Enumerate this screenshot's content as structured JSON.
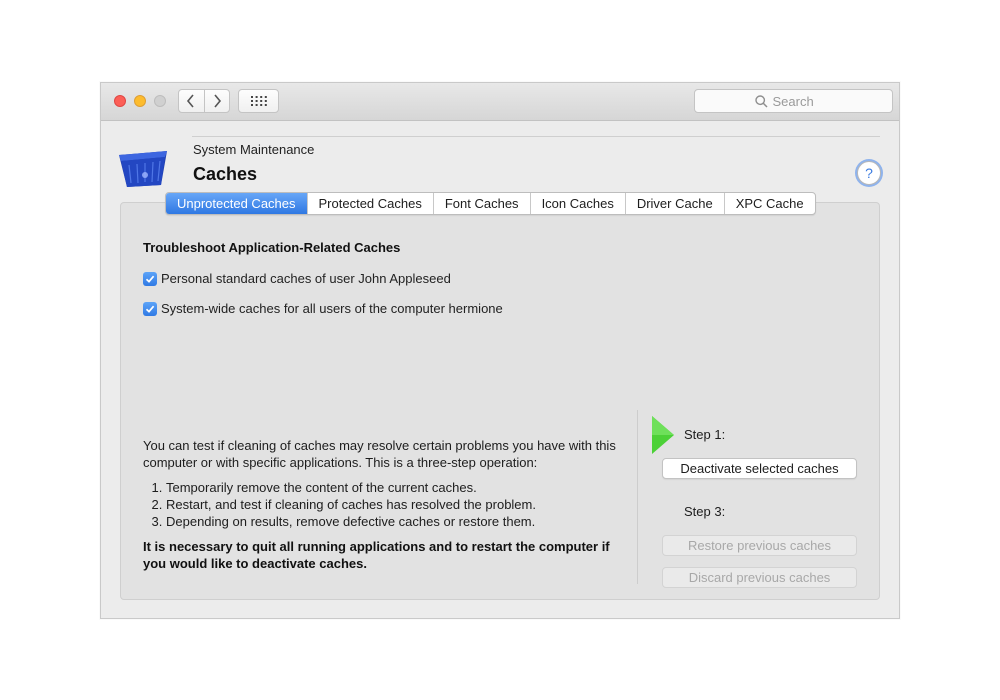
{
  "window": {
    "traffic_lights": [
      "close",
      "minimize",
      "zoom"
    ],
    "nav_back_icon": "chevron-left-icon",
    "nav_forward_icon": "chevron-right-icon",
    "grid_icon": "grid-icon",
    "search": {
      "placeholder": "Search",
      "value": "",
      "icon": "search-icon"
    }
  },
  "header": {
    "subtitle": "System Maintenance",
    "title": "Caches",
    "help_label": "?"
  },
  "tabs": [
    {
      "label": "Unprotected Caches",
      "active": true
    },
    {
      "label": "Protected Caches",
      "active": false
    },
    {
      "label": "Font Caches",
      "active": false
    },
    {
      "label": "Icon Caches",
      "active": false
    },
    {
      "label": "Driver Cache",
      "active": false
    },
    {
      "label": "XPC Cache",
      "active": false
    }
  ],
  "content": {
    "section_title": "Troubleshoot Application-Related Caches",
    "checkboxes": [
      {
        "label": "Personal standard caches of user John Appleseed",
        "checked": true
      },
      {
        "label": "System-wide caches for all users of the computer hermione",
        "checked": true
      }
    ],
    "intro": "You can test if cleaning of caches may resolve certain problems you have with this computer or with specific applications. This is a three-step operation:",
    "steps": [
      "Temporarily remove the content of the current caches.",
      "Restart, and test if cleaning of caches has resolved the problem.",
      "Depending on results, remove defective caches or restore them."
    ],
    "warning": "It is necessary to quit all running applications and to restart the computer if you would like to deactivate caches."
  },
  "actions": {
    "step1_label": "Step 1:",
    "deactivate_button": "Deactivate selected caches",
    "step3_label": "Step 3:",
    "restore_button": "Restore previous caches",
    "discard_button": "Discard previous caches"
  },
  "colors": {
    "accent": "#2f78e3",
    "step_arrow": "#4cd137",
    "close": "#fc5f57",
    "minimize": "#fdbc2e"
  }
}
